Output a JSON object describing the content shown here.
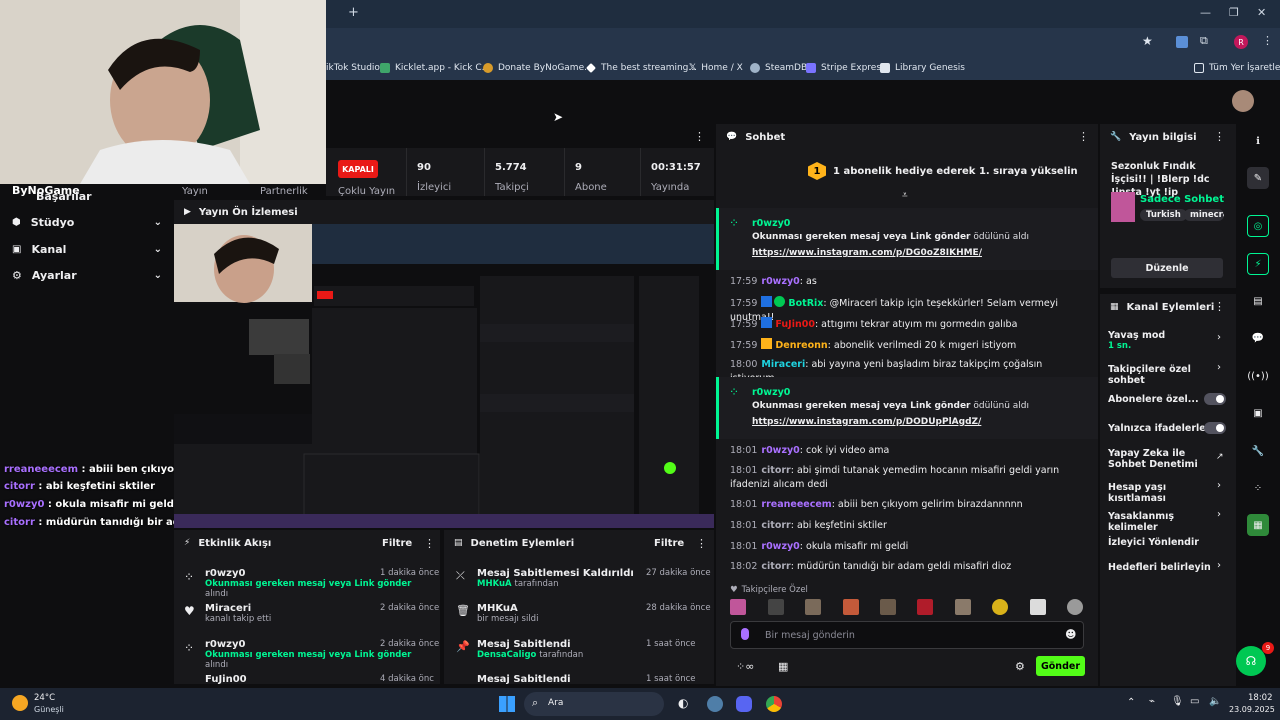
{
  "browser": {
    "bookmarks": [
      "ikTok Studio",
      "Kicklet.app - Kick C...",
      "Donate ByNoGame...",
      "The best streaming...",
      "Home / X",
      "SteamDB",
      "Stripe Express",
      "Library Genesis"
    ],
    "all_bookmarks": "Tüm Yer İşaretleri",
    "profile_letter": "R",
    "new_tab_symbol": "+"
  },
  "stats": {
    "status_badge": "KAPALI",
    "viewers_value": "90",
    "viewers_label": "İzleyici",
    "followers_value": "5.774",
    "followers_label": "Takipçi",
    "subs_value": "9",
    "subs_label": "Abone",
    "uptime_value": "00:31:57",
    "uptime_label": "Yayında",
    "cut_yayin": "Yayın",
    "cut_partnerlik": "Partnerlik",
    "cut_coklu": "Çoklu Yayın"
  },
  "sidebar": {
    "brand": "ByNoGame",
    "cut_item": "Başarılar",
    "items": [
      {
        "label": "Stüdyo"
      },
      {
        "label": "Kanal"
      },
      {
        "label": "Ayarlar"
      }
    ]
  },
  "overlay_chat": [
    {
      "user": "rreaneeecem",
      "msg": " : abiii ben çıkıyom gelirim birazdannnnn"
    },
    {
      "user": "citorr",
      "msg": " : abi keşfetini sktiler"
    },
    {
      "user": "r0wzy0",
      "msg": " : okula misafir mi geldi"
    },
    {
      "user": "citorr",
      "msg": " : müdürün tanıdığı bir adam geldi misafiri dioz"
    }
  ],
  "preview": {
    "title": "Yayın Ön İzlemesi"
  },
  "activity": {
    "title": "Etkinlik Akışı",
    "filter": "Filtre",
    "items": [
      {
        "name": "r0wzy0",
        "sub": "Okunması gereken mesaj veya Link gönder",
        "sub2": "alındı",
        "time": "1 dakika önce"
      },
      {
        "name": "Miraceri",
        "sub": "",
        "sub2": "kanalı takip etti",
        "time": "2 dakika önce"
      },
      {
        "name": "r0wzy0",
        "sub": "Okunması gereken mesaj veya Link gönder",
        "sub2": "alındı",
        "time": "2 dakika önce"
      },
      {
        "name": "FuJin00",
        "sub": "",
        "sub2": "",
        "time": "4 dakika önce"
      }
    ]
  },
  "moderation": {
    "title": "Denetim Eylemleri",
    "filter": "Filtre",
    "items": [
      {
        "name": "Mesaj Sabitlemesi Kaldırıldı",
        "sub": "MHKuA",
        "sub2": "tarafından",
        "time": "27 dakika önce"
      },
      {
        "name": "MHKuA",
        "sub": "",
        "sub2": "bir mesajı sildi",
        "time": "28 dakika önce"
      },
      {
        "name": "Mesaj Sabitlendi",
        "sub": "DensaCaligo",
        "sub2": "tarafından",
        "time": "1 saat önce"
      },
      {
        "name": "Mesaj Sabitlendi",
        "sub": "",
        "sub2": "",
        "time": "1 saat önce"
      }
    ]
  },
  "chat": {
    "title": "Sohbet",
    "gift_banner": "1 abonelik hediye ederek 1. sıraya yükselin",
    "gift_rank": "1",
    "reward1": {
      "user": "r0wzy0",
      "text": "Okunması gereken mesaj veya Link gönder",
      "suffix": " ödülünü aldı",
      "link": "https://www.instagram.com/p/DG0oZ8IKHME/"
    },
    "lines_a": [
      {
        "ts": "17:59",
        "user": "r0wzy0",
        "color": "#a970ff",
        "msg": ": as"
      },
      {
        "ts": "17:59",
        "user": "BotRix",
        "color": "#00f593",
        "msg": ": @Miraceri takip için teşekkürler! Selam vermeyi unutma!!"
      },
      {
        "ts": "17:59",
        "user": "FuJin00",
        "color": "#e91916",
        "msg": ": attıgımı tekrar atıyım mı gormedın galıba"
      },
      {
        "ts": "17:59",
        "user": "Denreonn",
        "color": "#ffb31a",
        "msg": ": abonelik verilmedi 20 k mıgeri istiyom"
      },
      {
        "ts": "18:00",
        "user": "Miraceri",
        "color": "#1fd3e0",
        "msg": ": abi yayına yeni başladım biraz takipçim çoğalsın istiyorum"
      }
    ],
    "reward2": {
      "user": "r0wzy0",
      "text": "Okunması gereken mesaj veya Link gönder",
      "suffix": " ödülünü aldı",
      "link": "https://www.instagram.com/p/DODUpPlAgdZ/"
    },
    "lines_b": [
      {
        "ts": "18:01",
        "user": "r0wzy0",
        "color": "#a970ff",
        "msg": ": cok iyi video ama"
      },
      {
        "ts": "18:01",
        "user": "citorr",
        "color": "#adadb8",
        "msg": ": abi şimdi tutanak yemedim hocanın misafiri geldi yarın ifadenizi alıcam dedi"
      },
      {
        "ts": "18:01",
        "user": "rreaneeecem",
        "color": "#a970ff",
        "msg": ": abiii ben çıkıyom gelirim birazdannnnn"
      },
      {
        "ts": "18:01",
        "user": "citorr",
        "color": "#adadb8",
        "msg": ": abi keşfetini sktiler"
      },
      {
        "ts": "18:01",
        "user": "r0wzy0",
        "color": "#a970ff",
        "msg": ": okula misafir mi geldi"
      },
      {
        "ts": "18:02",
        "user": "citorr",
        "color": "#adadb8",
        "msg": ": müdürün tanıdığı bir adam geldi misafiri dioz"
      }
    ],
    "followers_only": "Takipçilere Özel",
    "input_placeholder": "Bir mesaj gönderin",
    "send": "Gönder"
  },
  "stream_info": {
    "title": "Yayın bilgisi",
    "stream_title": "Sezonluk Fındık İşçisi!! | !Blerp !dc !insta !yt !ip",
    "category": "Sadece Sohbet",
    "tags": [
      "Turkish",
      "minecraf"
    ],
    "edit": "Düzenle"
  },
  "channel_actions": {
    "title": "Kanal Eylemleri",
    "slow_mode": "Yavaş mod",
    "slow_mode_value": "1 sn.",
    "followers_only": "Takipçilere özel sohbet",
    "subs_only": "Abonelere özel...",
    "emote_only": "Yalnızca ifadelerle...",
    "ai_mod": "Yapay Zeka ile Sohbet Denetimi",
    "account_age": "Hesap yaşı kısıtlaması",
    "banned_words": "Yasaklanmış kelimeler",
    "raid": "İzleyici Yönlendir",
    "goals": "Hedefleri belirleyin"
  },
  "taskbar": {
    "weather_temp": "24°C",
    "weather_desc": "Güneşli",
    "search": "Ara",
    "time": "18:02",
    "date": "23.09.2025"
  },
  "notification_count": "9",
  "colors": {
    "accent_green": "#53fc18",
    "kick_green": "#00f593",
    "live_red": "#e91916",
    "bg": "#0e0e10",
    "panel": "#18181b"
  }
}
